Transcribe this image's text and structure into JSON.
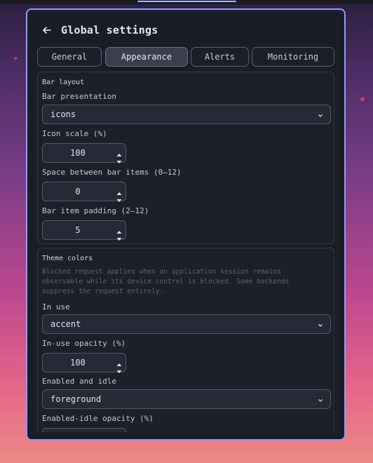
{
  "window": {
    "title": "Global settings",
    "back_icon": "arrow-left-icon"
  },
  "tabs": [
    {
      "label": "General",
      "active": false
    },
    {
      "label": "Appearance",
      "active": true
    },
    {
      "label": "Alerts",
      "active": false
    },
    {
      "label": "Monitoring",
      "active": false
    }
  ],
  "bar_layout": {
    "title": "Bar layout",
    "presentation": {
      "label": "Bar presentation",
      "value": "icons"
    },
    "icon_scale": {
      "label": "Icon scale (%)",
      "value": "100"
    },
    "space": {
      "label": "Space between bar items (0–12)",
      "value": "0"
    },
    "padding": {
      "label": "Bar item padding (2–12)",
      "value": "5"
    }
  },
  "theme_colors": {
    "title": "Theme colors",
    "help": "Blocked request applies when an application session remains observable while its device control is blocked. Some backends suppress the request entirely.",
    "in_use": {
      "label": "In use",
      "value": "accent"
    },
    "in_use_opacity": {
      "label": "In-use opacity (%)",
      "value": "100"
    },
    "enabled_idle": {
      "label": "Enabled and idle",
      "value": "foreground"
    },
    "enabled_idle_opacity": {
      "label": "Enabled-idle opacity (%)",
      "value": ""
    }
  },
  "colors": {
    "accent_border": "#8d9cf8",
    "panel_bg": "#1b1d26",
    "active_tab_bg": "#3a3e4d"
  }
}
